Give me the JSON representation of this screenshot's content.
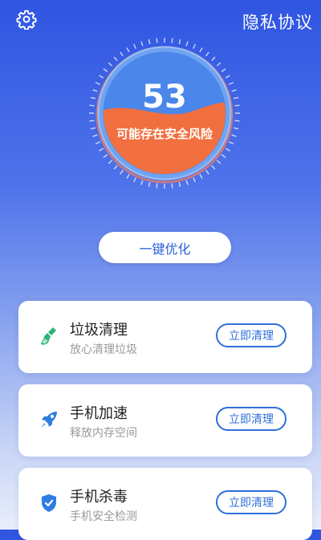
{
  "header": {
    "settings_icon": "gear-icon",
    "privacy_link": "隐私协议"
  },
  "score": {
    "value": "53",
    "status_text": "可能存在安全风险",
    "fill_fraction": 0.53,
    "fill_color": "#f26f3f",
    "ring_color": "#4b86ea"
  },
  "optimize_button": {
    "label": "一键优化"
  },
  "cards": [
    {
      "title": "垃圾清理",
      "subtitle": "放心清理垃圾",
      "button": "立即清理",
      "icon": "broom-icon",
      "icon_color": "#2bb673"
    },
    {
      "title": "手机加速",
      "subtitle": "释放内存空间",
      "button": "立即清理",
      "icon": "rocket-icon",
      "icon_color": "#2f7de1"
    },
    {
      "title": "手机杀毒",
      "subtitle": "手机安全检测",
      "button": "立即清理",
      "icon": "shield-check-icon",
      "icon_color": "#2f7de1"
    }
  ]
}
